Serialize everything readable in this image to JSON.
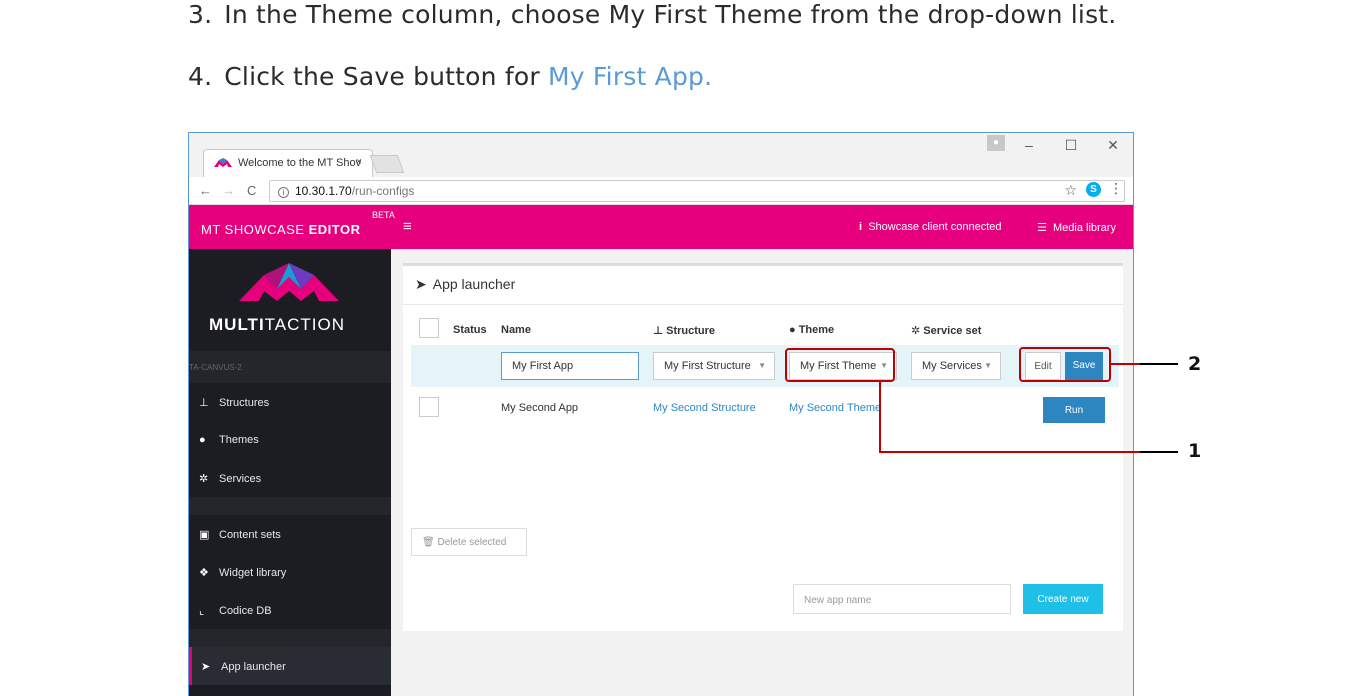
{
  "instructions": {
    "step3": {
      "num": "3.",
      "text": "In the Theme column, choose My First Theme from the drop-down list."
    },
    "step4": {
      "num": "4.",
      "text": "Click the Save button for ",
      "link": "My First App."
    }
  },
  "browser": {
    "tab_title": "Welcome to the MT Shov",
    "tab_close": "×",
    "url_host": "10.30.1.70",
    "url_path": "/run-configs",
    "win_min": "–",
    "win_max": "☐",
    "win_close": "✕"
  },
  "app_header": {
    "brand_light": "MT SHOWCASE ",
    "brand_bold": "EDITOR",
    "beta": "BETA",
    "client_status": "Showcase client connected",
    "media_library": "Media library"
  },
  "sidebar": {
    "logo_bold": "MULTI",
    "logo_light": "TACTION",
    "device": "TA-CANVUS-2",
    "items": [
      {
        "label": "Structures",
        "icon": "sitemap-icon"
      },
      {
        "label": "Themes",
        "icon": "palette-icon"
      },
      {
        "label": "Services",
        "icon": "cogs-icon"
      },
      {
        "label": "Content sets",
        "icon": "image-icon"
      },
      {
        "label": "Widget library",
        "icon": "cubes-icon"
      },
      {
        "label": "Codice DB",
        "icon": "codice-icon"
      },
      {
        "label": "App launcher",
        "icon": "rocket-icon"
      }
    ]
  },
  "launcher": {
    "title": "App launcher",
    "columns": {
      "status": "Status",
      "name": "Name",
      "structure": "Structure",
      "theme": "Theme",
      "service_set": "Service set"
    },
    "row1": {
      "name": "My First App",
      "structure": "My First Structure",
      "theme": "My First Theme",
      "services": "My Services",
      "edit_label": "Edit",
      "save_label": "Save"
    },
    "row2": {
      "name": "My Second App",
      "structure": "My Second Structure",
      "theme": "My Second Theme",
      "run_label": "Run"
    },
    "delete_label": "Delete selected",
    "new_app_placeholder": "New app name",
    "create_label": "Create new"
  },
  "callouts": {
    "one": "1",
    "two": "2",
    "color": "#c00000"
  }
}
